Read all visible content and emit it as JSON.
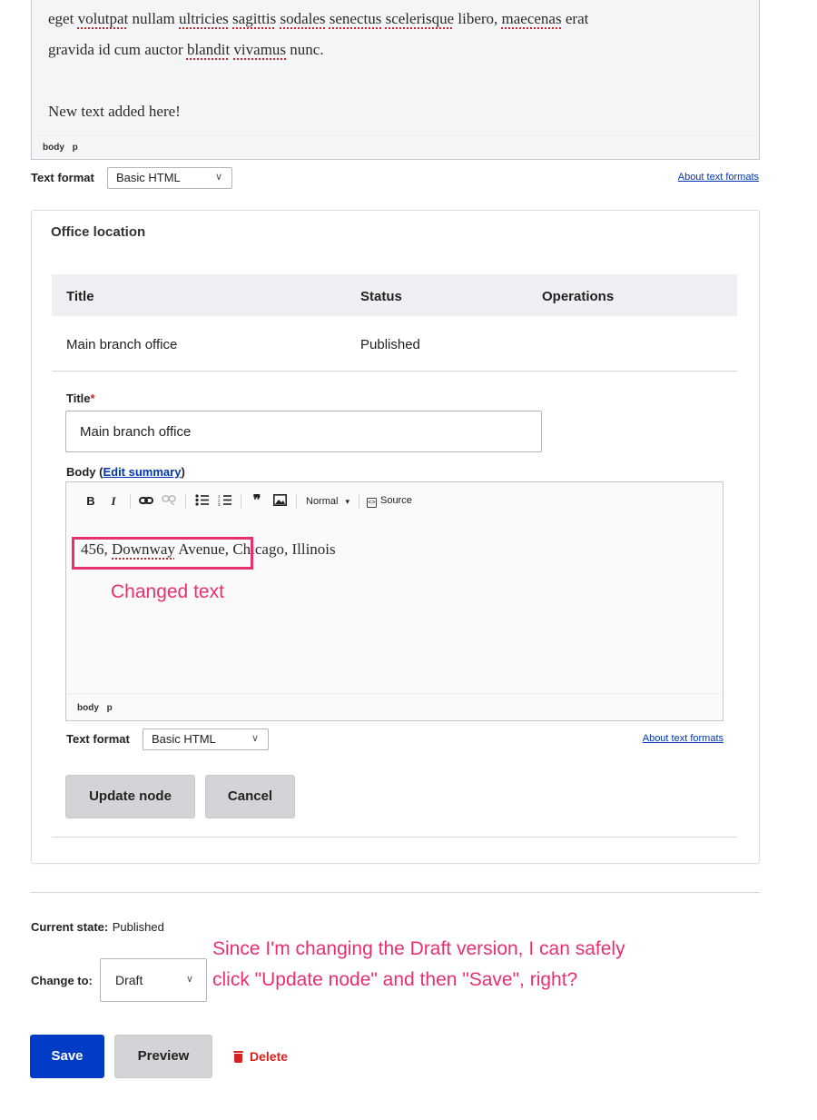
{
  "top_editor": {
    "line1_parts": [
      {
        "t": "eget ",
        "sq": false
      },
      {
        "t": "volutpat",
        "sq": true
      },
      {
        "t": " nullam ",
        "sq": false
      },
      {
        "t": "ultricies",
        "sq": true
      },
      {
        "t": " ",
        "sq": false
      },
      {
        "t": "sagittis",
        "sq": true
      },
      {
        "t": " ",
        "sq": false
      },
      {
        "t": "sodales",
        "sq": true
      },
      {
        "t": " ",
        "sq": false
      },
      {
        "t": "senectus",
        "sq": true
      },
      {
        "t": " ",
        "sq": false
      },
      {
        "t": "scelerisque",
        "sq": true
      },
      {
        "t": " libero, ",
        "sq": false
      },
      {
        "t": "maecenas",
        "sq": true
      },
      {
        "t": " erat",
        "sq": false
      }
    ],
    "line2_parts": [
      {
        "t": "gravida id cum auctor ",
        "sq": false
      },
      {
        "t": "blandit",
        "sq": true
      },
      {
        "t": " ",
        "sq": false
      },
      {
        "t": "vivamus",
        "sq": true
      },
      {
        "t": " nunc.",
        "sq": false
      }
    ],
    "new_text": "New text added here!",
    "path": [
      "body",
      "p"
    ]
  },
  "top_text_format": {
    "label": "Text format",
    "value": "Basic HTML",
    "about": "About text formats"
  },
  "office_location": {
    "legend": "Office location",
    "table": {
      "headers": [
        "Title",
        "Status",
        "Operations"
      ],
      "row": {
        "title": "Main branch office",
        "status": "Published"
      }
    },
    "title_label": "Title",
    "required_mark": "*",
    "title_value": "Main branch office",
    "body_label": "Body (",
    "edit_summary": "Edit summary",
    "body_label_close": ")",
    "toolbar": {
      "bold": "B",
      "italic": "I",
      "link_icon": "link-icon",
      "unlink_icon": "unlink-icon",
      "bullets_icon": "bulleted-list-icon",
      "numbers_icon": "numbered-list-icon",
      "quote": "❞",
      "image_icon": "image-icon",
      "format": "Normal",
      "source": "Source"
    },
    "body_text_boxed": "456, Downway Avenue,",
    "body_text_rest": " Chicago, Illinois",
    "path": [
      "body",
      "p"
    ],
    "text_format": {
      "label": "Text format",
      "value": "Basic HTML",
      "about": "About text formats"
    },
    "update_button": "Update node",
    "cancel_button": "Cancel"
  },
  "annotations": {
    "changed_text": "Changed text",
    "question_line1": "Since I'm changing the Draft version, I can safely",
    "question_line2": "click \"Update node\" and then \"Save\", right?",
    "color": "#e8306e"
  },
  "moderation": {
    "current_state_label": "Current state:",
    "current_state_value": "Published",
    "change_to_label": "Change to:",
    "change_to_value": "Draft"
  },
  "actions": {
    "save": "Save",
    "preview": "Preview",
    "delete": "Delete"
  },
  "colors": {
    "primary": "#003cc5",
    "danger": "#d72222",
    "link": "#0036b1"
  }
}
